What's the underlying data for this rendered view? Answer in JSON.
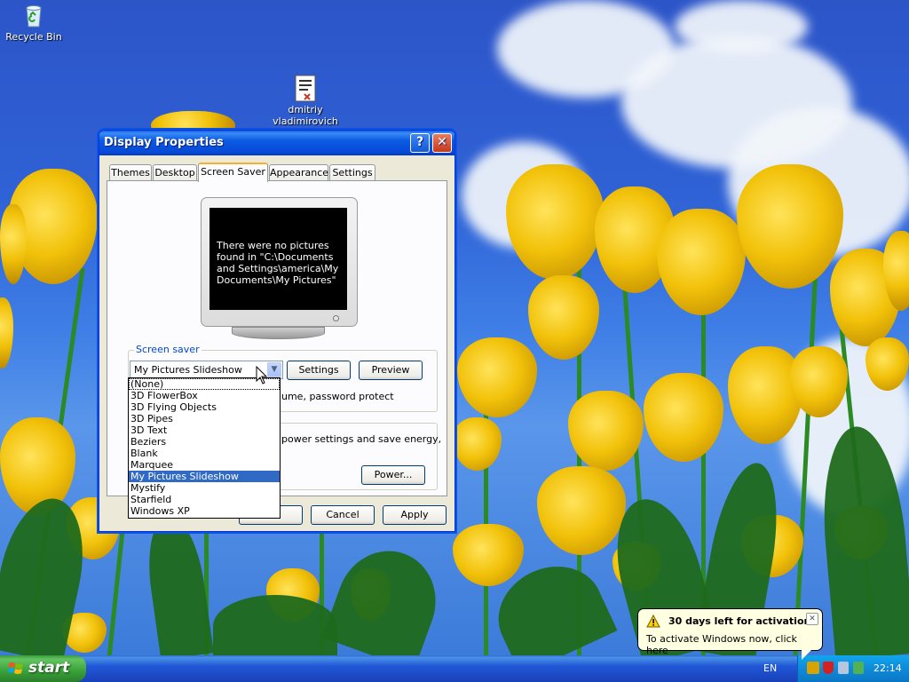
{
  "desktop": {
    "icons": [
      {
        "label": "Recycle Bin"
      },
      {
        "label_line1": "dmitriy",
        "label_line2": "vladimirovich"
      }
    ]
  },
  "window": {
    "title": "Display Properties",
    "help_glyph": "?",
    "close_glyph": "✕",
    "tabs": [
      {
        "label": "Themes"
      },
      {
        "label": "Desktop"
      },
      {
        "label": "Screen Saver",
        "active": true
      },
      {
        "label": "Appearance"
      },
      {
        "label": "Settings"
      }
    ],
    "preview_text": "There were no pictures found in \"C:\\Documents and Settings\\america\\My Documents\\My Pictures\"",
    "screen_saver": {
      "group_label": "Screen saver",
      "selected": "My Pictures Slideshow",
      "settings_label": "Settings",
      "preview_label": "Preview",
      "resume_text": "ume, password protect",
      "options": [
        "(None)",
        "3D FlowerBox",
        "3D Flying Objects",
        "3D Pipes",
        "3D Text",
        "Beziers",
        "Blank",
        "Marquee",
        "My Pictures Slideshow",
        "Mystify",
        "Starfield",
        "Windows XP"
      ]
    },
    "power": {
      "text": "power settings and save energy,",
      "button_label": "Power..."
    },
    "buttons": {
      "ok": "",
      "cancel": "Cancel",
      "apply": "Apply"
    }
  },
  "taskbar": {
    "start_label": "start",
    "language": "EN",
    "clock": "22:14"
  },
  "balloon": {
    "title": "30 days left for activation",
    "text": "To activate Windows now, click here",
    "close_glyph": "✕"
  },
  "colors": {
    "selection": "#316ac5",
    "titlebar": "#0548d6",
    "group_label": "#0046d5"
  }
}
